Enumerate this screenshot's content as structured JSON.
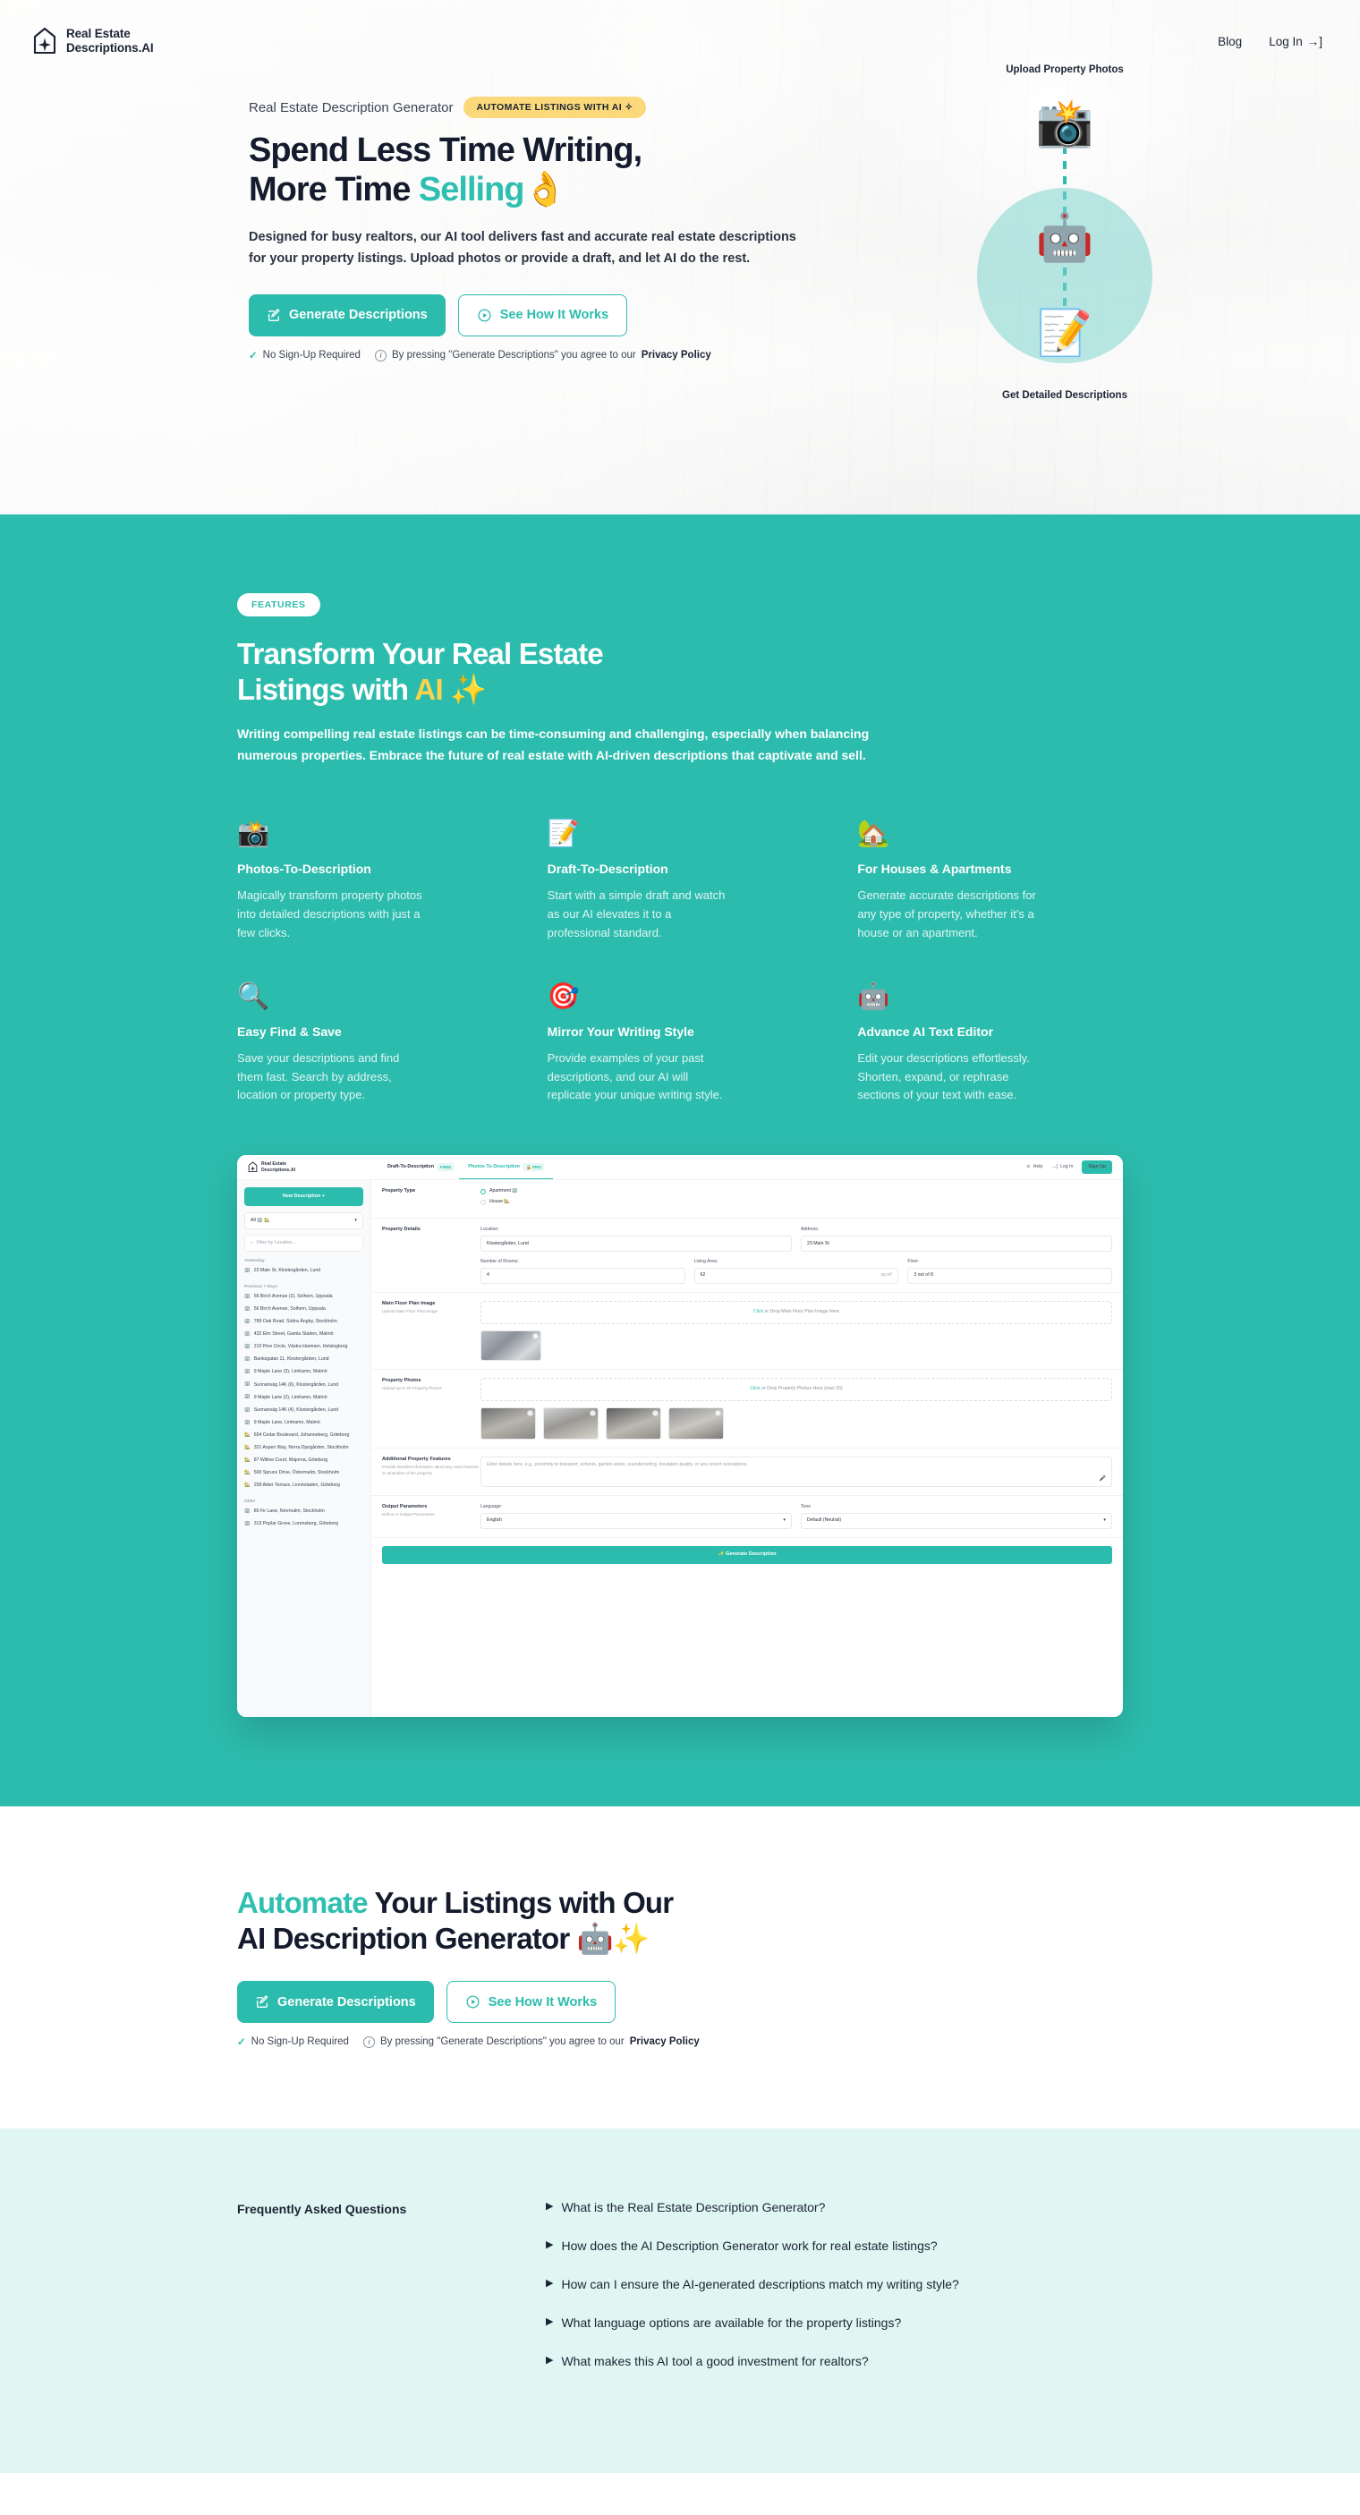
{
  "brand": {
    "name_line1": "Real Estate",
    "name_line2": "Descriptions.AI"
  },
  "header": {
    "blog": "Blog",
    "login": "Log In"
  },
  "hero": {
    "eyebrow": "Real Estate Description Generator",
    "badge": "AUTOMATE LISTINGS WITH AI ✧",
    "title_line1": "Spend Less Time Writing,",
    "title_line2_plain": "More Time ",
    "title_line2_accent": "Selling",
    "title_emoji": "👌",
    "description": "Designed for busy realtors, our AI tool delivers fast and accurate real estate descriptions for your property listings. Upload photos or provide a draft, and let AI do the rest.",
    "btn_primary": "Generate Descriptions",
    "btn_secondary": "See How It Works",
    "note_no_signup": "No Sign-Up Required",
    "note_agree": "By pressing \"Generate Descriptions\" you agree to our ",
    "note_privacy": "Privacy Policy",
    "illus_top_caption": "Upload Property Photos",
    "illus_bottom_caption": "Get Detailed Descriptions",
    "illus_camera": "📸",
    "illus_robot": "🤖",
    "illus_doc": "📝"
  },
  "features": {
    "tag": "FEATURES",
    "title_line1": "Transform Your Real Estate",
    "title_line2_plain": "Listings with ",
    "title_line2_accent": "AI",
    "title_emoji": "✨",
    "description": "Writing compelling real estate listings can be time-consuming and challenging, especially when balancing numerous properties. Embrace the future of real estate with AI-driven descriptions that captivate and sell.",
    "items": [
      {
        "icon": "📸",
        "title": "Photos-To-Description",
        "text": "Magically transform property photos into detailed descriptions with just a few clicks."
      },
      {
        "icon": "📝",
        "title": "Draft-To-Description",
        "text": "Start with a simple draft and watch as our AI elevates it to a professional standard."
      },
      {
        "icon": "🏡",
        "title": "For Houses & Apartments",
        "text": "Generate accurate descriptions for any type of property, whether it's a house or an apartment."
      },
      {
        "icon": "🔍",
        "title": "Easy Find & Save",
        "text": "Save your descriptions and find them fast. Search by address, location or property type."
      },
      {
        "icon": "🎯",
        "title": "Mirror Your Writing Style",
        "text": "Provide examples of your past descriptions, and our AI will replicate your unique writing style."
      },
      {
        "icon": "🤖",
        "title": "Advance AI Text Editor",
        "text": "Edit your descriptions effortlessly. Shorten, expand, or rephrase sections of your text with ease."
      }
    ]
  },
  "mockup": {
    "tabs": [
      {
        "label": "Draft-To-Description",
        "tag": "FREE",
        "active": false
      },
      {
        "label": "Photos-To-Description",
        "tag": "🔒 PRO",
        "active": true
      }
    ],
    "help": "Help",
    "login": "Log In",
    "signup": "Sign Up",
    "new_description": "New Description  +",
    "filter_select": "All 🏢 🏡",
    "filter_placeholder": "Filter by Location...",
    "groups": [
      {
        "label": "Yesterday",
        "items": [
          {
            "icon": "🏢",
            "text": "23 Main St, Klostergården, Lund"
          }
        ]
      },
      {
        "label": "Previous 7 Days",
        "items": [
          {
            "icon": "🏢",
            "text": "56 Birch Avenue (2), Solhem, Uppsala"
          },
          {
            "icon": "🏢",
            "text": "56 Birch Avenue, Solhem, Uppsala"
          },
          {
            "icon": "🏢",
            "text": "789 Oak Road, Södra Ängby, Stockholm"
          },
          {
            "icon": "🏢",
            "text": "432 Elm Street, Gamla Staden, Malmö"
          },
          {
            "icon": "🏢",
            "text": "210 Pine Circle, Västra Hamnen, Helsingborg"
          },
          {
            "icon": "🏢",
            "text": "Banksgatan 11, Klostergården, Lund"
          },
          {
            "icon": "🏢",
            "text": "9 Maple Lane (3), Limhamn, Malmö"
          },
          {
            "icon": "🏢",
            "text": "Sunnanväg 14K (6), Klostergården, Lund"
          },
          {
            "icon": "🏢",
            "text": "9 Maple Lane (2), Limhamn, Malmö"
          },
          {
            "icon": "🏢",
            "text": "Sunnanväg 14K (4), Klostergården, Lund"
          },
          {
            "icon": "🏢",
            "text": "9 Maple Lane, Limhamn, Malmö"
          },
          {
            "icon": "🏡",
            "text": "654 Cedar Boulevard, Johanneberg, Göteborg"
          },
          {
            "icon": "🏡",
            "text": "321 Aspen Way, Norra Djurgården, Stockholm"
          },
          {
            "icon": "🏡",
            "text": "87 Willow Court, Majorna, Göteborg"
          },
          {
            "icon": "🏡",
            "text": "500 Spruce Drive, Östermalm, Stockholm"
          },
          {
            "icon": "🏡",
            "text": "258 Alder Terrace, Linnéstaden, Göteborg"
          }
        ]
      },
      {
        "label": "Older",
        "items": [
          {
            "icon": "🏢",
            "text": "85 Fir Lane, Norrmalm, Stockholm"
          },
          {
            "icon": "🏢",
            "text": "313 Poplar Grove, Lorensberg, Göteborg"
          }
        ]
      }
    ],
    "property_type_label": "Property Type",
    "property_type_options": [
      {
        "label": "Apartment 🏢",
        "selected": true
      },
      {
        "label": "House 🏡",
        "selected": false
      }
    ],
    "property_details_label": "Property Details",
    "location_label": "Location:",
    "location_value": "Klostergården, Lund",
    "address_label": "Address:",
    "address_value": "23 Main St",
    "rooms_label": "Number of Rooms:",
    "rooms_value": "4",
    "living_area_label": "Living Area:",
    "living_area_value": "62",
    "living_area_unit": "sq m²",
    "floor_label": "Floor:",
    "floor_value": "3 out of 8",
    "floorplan_title": "Main Floor Plan Image",
    "floorplan_sub": "Upload Main Floor Plan Image",
    "floorplan_drop_link": "Click",
    "floorplan_drop_rest": " or Drop Main Floor Plan Image Here",
    "photos_title": "Property Photos",
    "photos_sub": "Upload up to 20 Property Photos",
    "photos_drop_link": "Click",
    "photos_drop_rest": " or Drop Property Photos Here (max 20)",
    "extra_title": "Additional Property Features",
    "extra_sub": "Provide detailed information about any extra features or amenities of the property.",
    "extra_placeholder": "Enter details here, e.g., proximity to transport, schools, garden views, soundproofing, insulation quality, or any recent renovations.",
    "output_title": "Output Parameters",
    "output_sub": "Define AI Output Parameters",
    "language_label": "Language:",
    "language_value": "English",
    "tone_label": "Tone",
    "tone_value": "Default (Neutral)",
    "generate_button": "Generate Description"
  },
  "cta": {
    "title_accent": "Automate",
    "title_rest1": " Your Listings with Our",
    "title_line2": "AI Description Generator ",
    "title_emoji": "🤖✨",
    "btn_primary": "Generate Descriptions",
    "btn_secondary": "See How It Works",
    "note_no_signup": "No Sign-Up Required",
    "note_agree": "By pressing \"Generate Descriptions\" you agree to our ",
    "note_privacy": "Privacy Policy"
  },
  "faq": {
    "heading": "Frequently Asked Questions",
    "questions": [
      "What is the Real Estate Description Generator?",
      "How does the AI Description Generator work for real estate listings?",
      "How can I ensure the AI-generated descriptions match my writing style?",
      "What language options are available for the property listings?",
      "What makes this AI tool a good investment for realtors?"
    ]
  },
  "colors": {
    "teal": "#2cbcad",
    "yellow": "#fbd34d",
    "badge_yellow": "#fbd97a",
    "faq_bg": "#e0f6f2",
    "dark": "#141b2d"
  }
}
